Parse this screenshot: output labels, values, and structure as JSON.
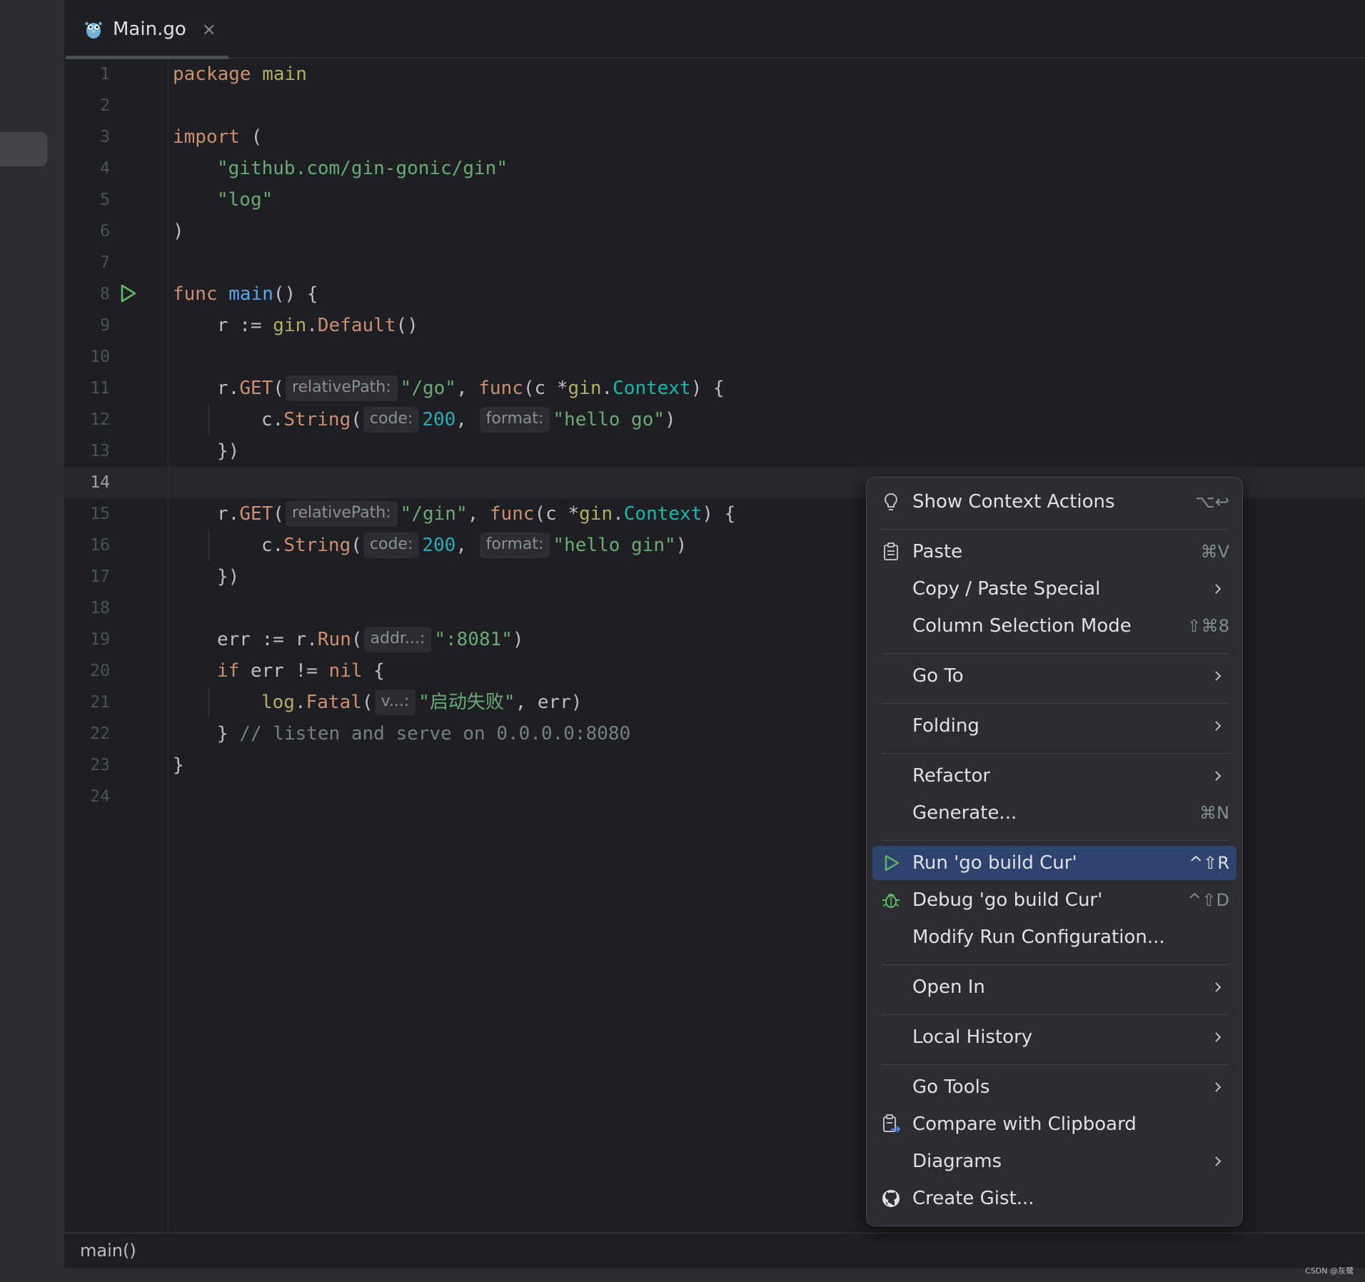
{
  "editor": {
    "tab": {
      "label": "Main.go",
      "close": "×"
    },
    "line_numbers": [
      "1",
      "2",
      "3",
      "4",
      "5",
      "6",
      "7",
      "8",
      "9",
      "10",
      "11",
      "12",
      "13",
      "14",
      "15",
      "16",
      "17",
      "18",
      "19",
      "20",
      "21",
      "22",
      "23",
      "24"
    ],
    "current_line": "14",
    "code": {
      "l1": [
        "package",
        " ",
        "main"
      ],
      "l3": [
        "import",
        " ("
      ],
      "l4": "\"github.com/gin-gonic/gin\"",
      "l5": "\"log\"",
      "l6": ")",
      "l8": [
        "func",
        " ",
        "main",
        "() {"
      ],
      "l9": [
        "r := ",
        "gin",
        ".",
        "Default",
        "()"
      ],
      "l11": [
        "r.",
        "GET",
        "(",
        "relativePath:",
        "\"/go\"",
        ", ",
        "func",
        "(c *",
        "gin",
        ".",
        "Context",
        ") {"
      ],
      "l12": [
        "c.",
        "String",
        "(",
        "code:",
        "200",
        ", ",
        "format:",
        "\"hello go\"",
        ")"
      ],
      "l13": "})",
      "l15": [
        "r.",
        "GET",
        "(",
        "relativePath:",
        "\"/gin\"",
        ", ",
        "func",
        "(c *",
        "gin",
        ".",
        "Context",
        ") {"
      ],
      "l16": [
        "c.",
        "String",
        "(",
        "code:",
        "200",
        ", ",
        "format:",
        "\"hello gin\"",
        ")"
      ],
      "l17": "})",
      "l19": [
        "err := r.",
        "Run",
        "(",
        "addr...:",
        "\":8081\"",
        ")"
      ],
      "l20": [
        "if",
        " err != ",
        "nil",
        " {"
      ],
      "l21": [
        "log",
        ".",
        "Fatal",
        "(",
        "v...:",
        "\"启动失败\"",
        ", err)"
      ],
      "l22": [
        "} ",
        "// listen and serve on 0.0.0.0:8080"
      ],
      "l23": "}"
    }
  },
  "breadcrumb": {
    "label": "main()"
  },
  "watermark": "CSDN @灰鹭",
  "context_menu": {
    "items": [
      {
        "label": "Show Context Actions",
        "shortcut": "⌥↩",
        "icon": "lightbulb-icon"
      },
      {
        "label": "Paste",
        "shortcut": "⌘V",
        "icon": "clipboard-icon"
      },
      {
        "label": "Copy / Paste Special",
        "submenu": true
      },
      {
        "label": "Column Selection Mode",
        "shortcut": "⇧⌘8"
      },
      {
        "label": "Go To",
        "submenu": true
      },
      {
        "label": "Folding",
        "submenu": true
      },
      {
        "label": "Refactor",
        "submenu": true
      },
      {
        "label": "Generate...",
        "shortcut": "⌘N"
      },
      {
        "label": "Run 'go build Cur'",
        "shortcut": "^⇧R",
        "icon": "run-icon",
        "selected": true
      },
      {
        "label": "Debug 'go build Cur'",
        "shortcut": "^⇧D",
        "icon": "debug-bug-icon"
      },
      {
        "label": "Modify Run Configuration..."
      },
      {
        "label": "Open In",
        "submenu": true
      },
      {
        "label": "Local History",
        "submenu": true
      },
      {
        "label": "Go Tools",
        "submenu": true
      },
      {
        "label": "Compare with Clipboard",
        "icon": "compare-clipboard-icon"
      },
      {
        "label": "Diagrams",
        "submenu": true
      },
      {
        "label": "Create Gist...",
        "icon": "github-icon"
      }
    ]
  },
  "colors": {
    "background": "#1e1f22",
    "menu_background": "#2b2d30",
    "selection": "#2e436e",
    "keyword": "#cf8e6d",
    "string": "#6aab73",
    "number": "#2aacb8",
    "function": "#56a8f5",
    "run_green": "#5fb865"
  }
}
